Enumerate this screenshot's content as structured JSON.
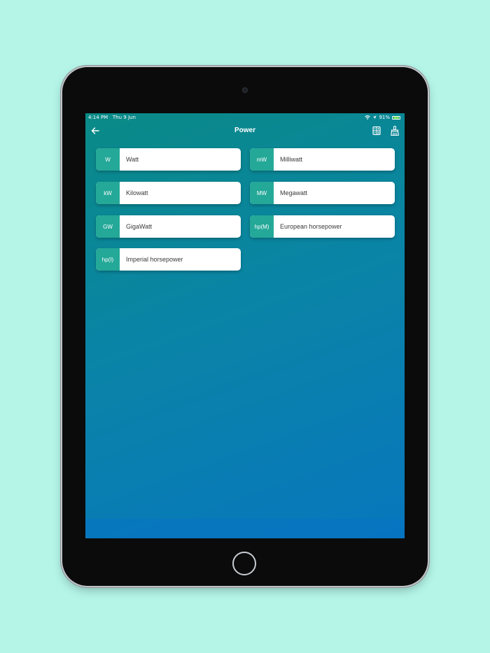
{
  "status_bar": {
    "time": "4:14 PM",
    "date": "Thu 9 Jun",
    "battery": "91%"
  },
  "nav": {
    "title": "Power",
    "back_icon": "arrow-left-icon",
    "calculator_icon": "calculator-icon",
    "clean_icon": "broom-icon"
  },
  "units": [
    {
      "symbol": "W",
      "name": "Watt"
    },
    {
      "symbol": "mW",
      "name": "Milliwatt"
    },
    {
      "symbol": "kW",
      "name": "Kilowatt"
    },
    {
      "symbol": "MW",
      "name": "Megawatt"
    },
    {
      "symbol": "GW",
      "name": "GigaWatt"
    },
    {
      "symbol": "hp(M)",
      "name": "European horsepower"
    },
    {
      "symbol": "hp(I)",
      "name": "Imperial horsepower"
    }
  ],
  "colors": {
    "accent": "#24a898",
    "background_top": "#0a8a86",
    "background_bottom": "#0777bd",
    "page_background": "#b4f5e8"
  }
}
